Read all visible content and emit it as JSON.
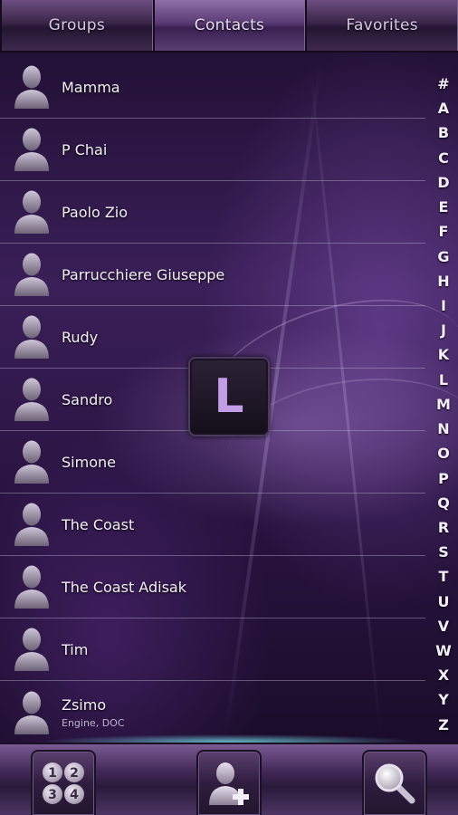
{
  "tabs": [
    {
      "label": "Groups"
    },
    {
      "label": "Contacts"
    },
    {
      "label": "Favorites"
    }
  ],
  "contacts": [
    {
      "name": "Mamma",
      "sub": ""
    },
    {
      "name": "P Chai",
      "sub": ""
    },
    {
      "name": "Paolo Zio",
      "sub": ""
    },
    {
      "name": "Parrucchiere Giuseppe",
      "sub": ""
    },
    {
      "name": "Rudy",
      "sub": ""
    },
    {
      "name": "Sandro",
      "sub": ""
    },
    {
      "name": "Simone",
      "sub": ""
    },
    {
      "name": "The Coast",
      "sub": ""
    },
    {
      "name": "The Coast Adisak",
      "sub": ""
    },
    {
      "name": "Tim",
      "sub": ""
    },
    {
      "name": "Zsimo",
      "sub": "Engine, DOC"
    }
  ],
  "index_letters": [
    "#",
    "A",
    "B",
    "C",
    "D",
    "E",
    "F",
    "G",
    "H",
    "I",
    "J",
    "K",
    "L",
    "M",
    "N",
    "O",
    "P",
    "Q",
    "R",
    "S",
    "T",
    "U",
    "V",
    "W",
    "X",
    "Y",
    "Z"
  ],
  "overlay_letter": "L",
  "dialpad_digits": [
    "1",
    "2",
    "3",
    "4"
  ],
  "icons": {
    "dialpad": "dialpad-icon",
    "add_contact": "add-contact-icon",
    "search": "search-icon",
    "avatar": "person-avatar-icon"
  },
  "colors": {
    "accent": "#c39de8",
    "tab_text": "#d7c8e6",
    "glow": "#78e6f0"
  }
}
